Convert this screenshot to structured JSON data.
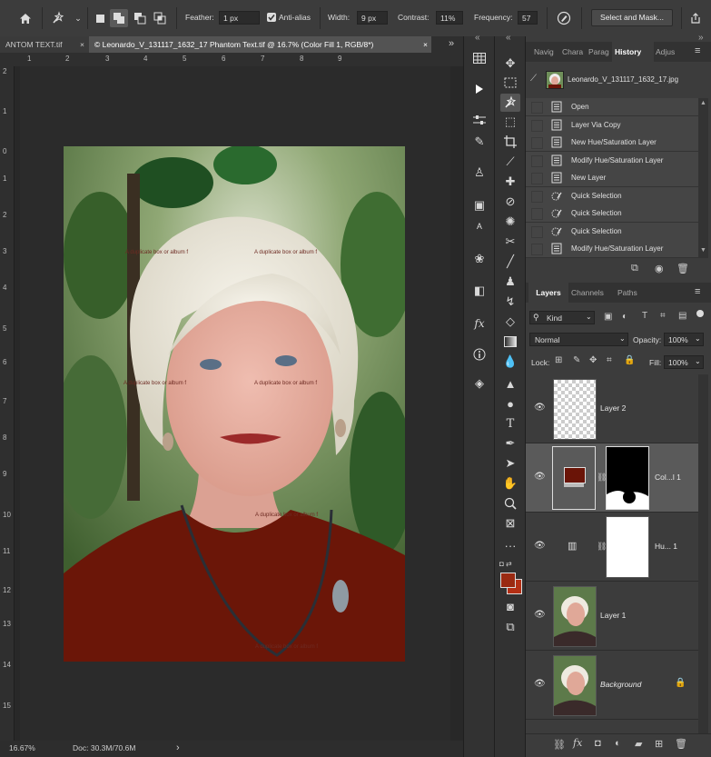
{
  "options_bar": {
    "feather_label": "Feather:",
    "feather_value": "1 px",
    "antialias_label": "Anti-alias",
    "width_label": "Width:",
    "width_value": "9 px",
    "contrast_label": "Contrast:",
    "contrast_value": "11%",
    "frequency_label": "Frequency:",
    "frequency_value": "57",
    "select_mask_label": "Select and Mask..."
  },
  "tabs": [
    {
      "label": "ANTOM TEXT.tif",
      "close": "×"
    },
    {
      "label": "© Leonardo_V_131117_1632_17 Phantom Text.tif @ 16.7% (Color Fill 1, RGB/8*)",
      "close": "×"
    }
  ],
  "rulers": {
    "h": [
      "1",
      "2",
      "3",
      "4",
      "5",
      "6",
      "7",
      "8",
      "9"
    ],
    "v": [
      "2",
      "1",
      "0",
      "1",
      "2",
      "3",
      "4",
      "5",
      "6",
      "7",
      "8",
      "9",
      "10",
      "11",
      "12",
      "13",
      "14",
      "15"
    ]
  },
  "watermarks": [
    "A duplicate box or album f",
    "A duplicate box or album f",
    "A duplicate box or album f",
    "A duplicate box or album f",
    "A duplicate box or album f",
    "A duplicate box or album f"
  ],
  "status": {
    "zoom": "16.67%",
    "doc": "Doc: 30.3M/70.6M",
    "arrow": "›"
  },
  "history_panel": {
    "tabs": [
      "Navig",
      "Chara",
      "Parag",
      "History",
      "Adjus"
    ],
    "active_tab": "History",
    "snapshot": "Leonardo_V_131117_1632_17.jpg",
    "items": [
      "Open",
      "Layer Via Copy",
      "New Hue/Saturation Layer",
      "Modify Hue/Saturation Layer",
      "New Layer",
      "Quick Selection",
      "Quick Selection",
      "Quick Selection",
      "Modify Hue/Saturation Layer"
    ]
  },
  "layers_panel": {
    "tabs": [
      "Layers",
      "Channels",
      "Paths"
    ],
    "active_tab": "Layers",
    "kind_label": "Kind",
    "blend_mode": "Normal",
    "opacity_label": "Opacity:",
    "opacity_value": "100%",
    "lock_label": "Lock:",
    "fill_label": "Fill:",
    "fill_value": "100%",
    "layers": [
      {
        "name": "Layer 2"
      },
      {
        "name": "Col...l 1"
      },
      {
        "name": "Hu... 1"
      },
      {
        "name": "Layer 1"
      },
      {
        "name": "Background"
      }
    ]
  },
  "colors": {
    "foreground": "#9a2a12",
    "background": "#b32f14",
    "color_fill_swatch": "#6a1407",
    "shirt": "#6b1608"
  }
}
